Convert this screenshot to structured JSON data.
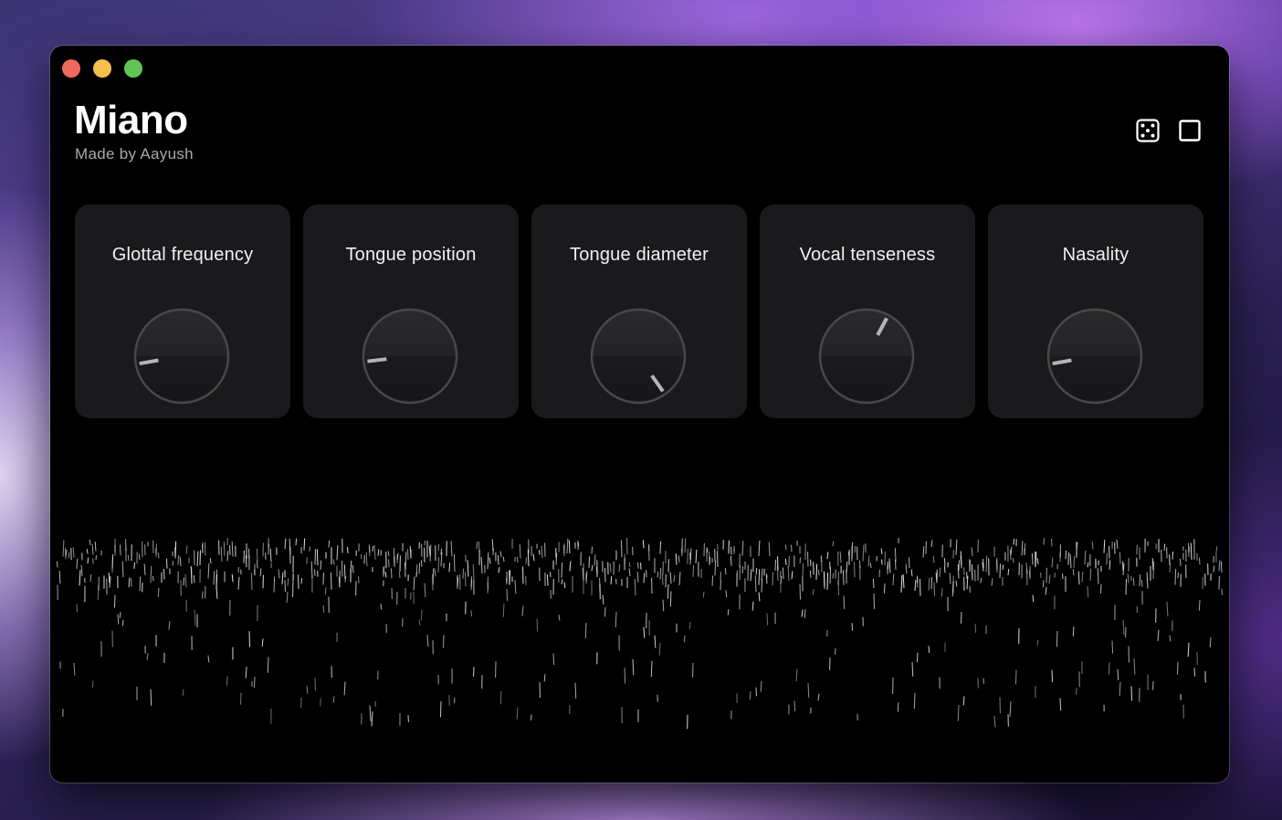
{
  "window": {
    "title": "Miano",
    "subtitle": "Made by Aayush",
    "traffic_lights": [
      "close",
      "minimize",
      "zoom"
    ]
  },
  "header": {
    "icons": [
      {
        "name": "dice-icon",
        "purpose": "randomize"
      },
      {
        "name": "stop-icon",
        "purpose": "stop"
      }
    ]
  },
  "knobs": [
    {
      "label": "Glottal frequency",
      "value_angle_deg": 260
    },
    {
      "label": "Tongue position",
      "value_angle_deg": 263
    },
    {
      "label": "Tongue diameter",
      "value_angle_deg": 145
    },
    {
      "label": "Vocal tenseness",
      "value_angle_deg": 28
    },
    {
      "label": "Nasality",
      "value_angle_deg": 260
    }
  ],
  "colors": {
    "window_bg": "#000000",
    "card_bg": "#1a1a1c",
    "knob_indicator": "#b5b5b8",
    "text_primary": "#ffffff",
    "text_secondary": "#a9a9ad"
  }
}
